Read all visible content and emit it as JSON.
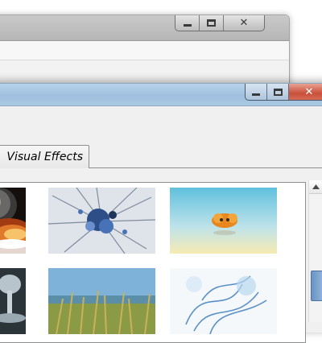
{
  "background_window": {
    "controls": {
      "minimize": "minimize",
      "maximize": "maximize",
      "close": "close"
    }
  },
  "foreground_window": {
    "controls": {
      "minimize": "minimize",
      "maximize": "maximize",
      "close": "close"
    },
    "tabs": [
      {
        "label": "Visual Effects"
      }
    ]
  },
  "gallery": {
    "thumbnails": [
      {
        "name": "planet-explosion",
        "dominant_colors": [
          "#1b1410",
          "#d77a2a"
        ]
      },
      {
        "name": "abstract-blue-splash",
        "dominant_colors": [
          "#d8dde4",
          "#3f67a8"
        ]
      },
      {
        "name": "orange-fish-on-sky",
        "dominant_colors": [
          "#8fd1e6",
          "#f7e9a8"
        ]
      },
      {
        "name": "water-splash",
        "dominant_colors": [
          "#8b98a2",
          "#2a3236"
        ]
      },
      {
        "name": "beach-grass",
        "dominant_colors": [
          "#7fb2d9",
          "#7b8f3b"
        ]
      },
      {
        "name": "blue-jellyfish-lines",
        "dominant_colors": [
          "#ffffff",
          "#3b7fc3"
        ]
      }
    ]
  },
  "colors": {
    "active_titlebar": "#9ec0de",
    "close_button": "#c9503a",
    "scrollbar_thumb": "#6a93c2"
  }
}
